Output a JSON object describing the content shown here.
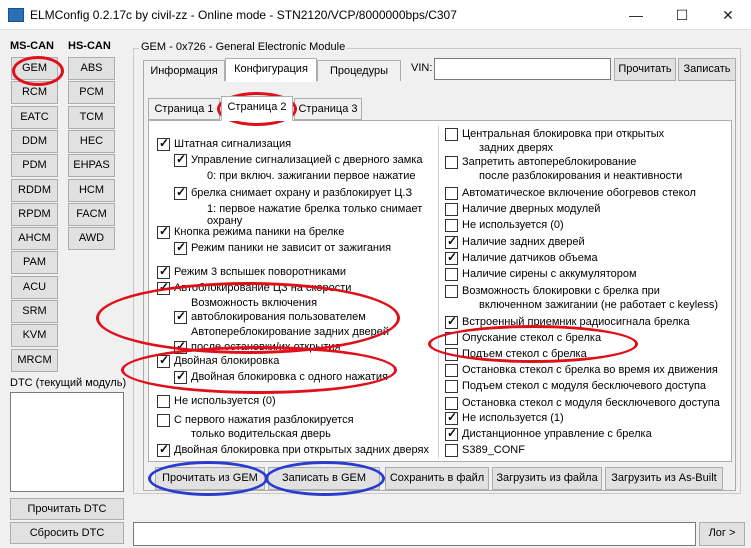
{
  "window": {
    "title": "ELMConfig 0.2.17c by civil-zz - Online mode - STN2120/VCP/8000000bps/C307",
    "minimize": "—",
    "maximize": "☐",
    "close": "✕"
  },
  "sidebar": {
    "ms_can_label": "MS-CAN",
    "hs_can_label": "HS-CAN",
    "ms_can_modules": [
      "GEM",
      "RCM",
      "EATC",
      "DDM",
      "PDM",
      "RDDM",
      "RPDM",
      "AHCM",
      "PAM",
      "ACU",
      "SRM",
      "KVM",
      "MRCM"
    ],
    "hs_can_modules": [
      "ABS",
      "PCM",
      "TCM",
      "HEC",
      "EHPAS",
      "HCM",
      "FACM",
      "AWD"
    ],
    "dtc_label": "DTC (текущий модуль)",
    "read_dtc": "Прочитать DTC",
    "reset_dtc": "Сбросить DTC"
  },
  "module": {
    "group_title": "GEM - 0x726 - General Electronic Module",
    "tabs": [
      "Информация",
      "Конфигурация",
      "Процедуры"
    ],
    "vin_label": "VIN:",
    "vin_value": "",
    "read_button": "Прочитать",
    "write_button": "Записать",
    "pages": [
      "Страница 1",
      "Страница 2",
      "Страница 3"
    ]
  },
  "options_left": [
    {
      "text": "Штатная сигнализация",
      "checked": true
    },
    {
      "text": "Управление сигнализацией с дверного замка",
      "checked": true
    },
    {
      "text": "0:  при включ. зажигании первое нажатие",
      "checked": null
    },
    {
      "text": "брелка снимает охрану и разблокирует Ц.З",
      "checked": true
    },
    {
      "text": "1: первое нажатие брелка только снимает",
      "checked": null
    },
    {
      "text": "охрану",
      "checked": null
    },
    {
      "text": "Кнопка режима паники на брелке",
      "checked": true
    },
    {
      "text": "Режим паники не зависит от зажигания",
      "checked": true
    },
    {
      "text": "Режим 3 вспышек поворотниками",
      "checked": true
    },
    {
      "text": "Автоблокирование ЦЗ на скорости",
      "checked": true
    },
    {
      "text": "Возможность включения",
      "checked": null
    },
    {
      "text": "автоблокирования пользователем",
      "checked": true
    },
    {
      "text": "Автопереблокирование задних дверей",
      "checked": null
    },
    {
      "text": "после остановки/их открытия",
      "checked": true
    },
    {
      "text": "Двойная блокировка",
      "checked": true
    },
    {
      "text": "Двойная блокировка с одного нажатия",
      "checked": true
    },
    {
      "text": "Не используется (0)",
      "checked": false
    },
    {
      "text": "С первого нажатия разблокируется",
      "checked": false
    },
    {
      "text": "только водительская дверь",
      "checked": null
    },
    {
      "text": "Двойная блокировка при открытых задних дверях",
      "checked": true
    }
  ],
  "options_right": [
    {
      "text": "Центральная блокировка при открытых",
      "checked": false
    },
    {
      "text": "задних дверях",
      "checked": null
    },
    {
      "text": "Запретить автопереблокирование",
      "checked": false
    },
    {
      "text": "после разблокирования и неактивности",
      "checked": null
    },
    {
      "text": "Автоматическое включение обогревов стекол",
      "checked": false
    },
    {
      "text": "Наличие дверных модулей",
      "checked": false
    },
    {
      "text": "Не используется (0)",
      "checked": false
    },
    {
      "text": "Наличие задних дверей",
      "checked": true
    },
    {
      "text": "Наличие датчиков объема",
      "checked": true
    },
    {
      "text": "Наличие сирены с аккумулятором",
      "checked": false
    },
    {
      "text": "Возможность блокировки с брелка при",
      "checked": false
    },
    {
      "text": "включенном зажигании (не работает с keyless)",
      "checked": null
    },
    {
      "text": "Встроенный приемник радиосигнала брелка",
      "checked": true
    },
    {
      "text": "Опускание стекол с брелка",
      "checked": false
    },
    {
      "text": "Подъем стекол с брелка",
      "checked": false
    },
    {
      "text": "Остановка стекол с брелка во время их движения",
      "checked": false
    },
    {
      "text": "Подъем стекол с модуля бесключевого доступа",
      "checked": false
    },
    {
      "text": "Остановка стекол с модуля бесключевого доступа",
      "checked": false
    },
    {
      "text": "Не используется (1)",
      "checked": true
    },
    {
      "text": "Дистанционное управление с брелка",
      "checked": true
    },
    {
      "text": "S389_CONF",
      "checked": false
    }
  ],
  "actions": {
    "read_from_gem": "Прочитать из GEM",
    "write_to_gem": "Записать в GEM",
    "save_to_file": "Сохранить в файл",
    "load_from_file": "Загрузить из файла",
    "load_as_built": "Загрузить из As-Built"
  },
  "log_button": "Лог >",
  "annotation_colors": {
    "red": "#e0101a",
    "blue": "#2a3bd0"
  }
}
